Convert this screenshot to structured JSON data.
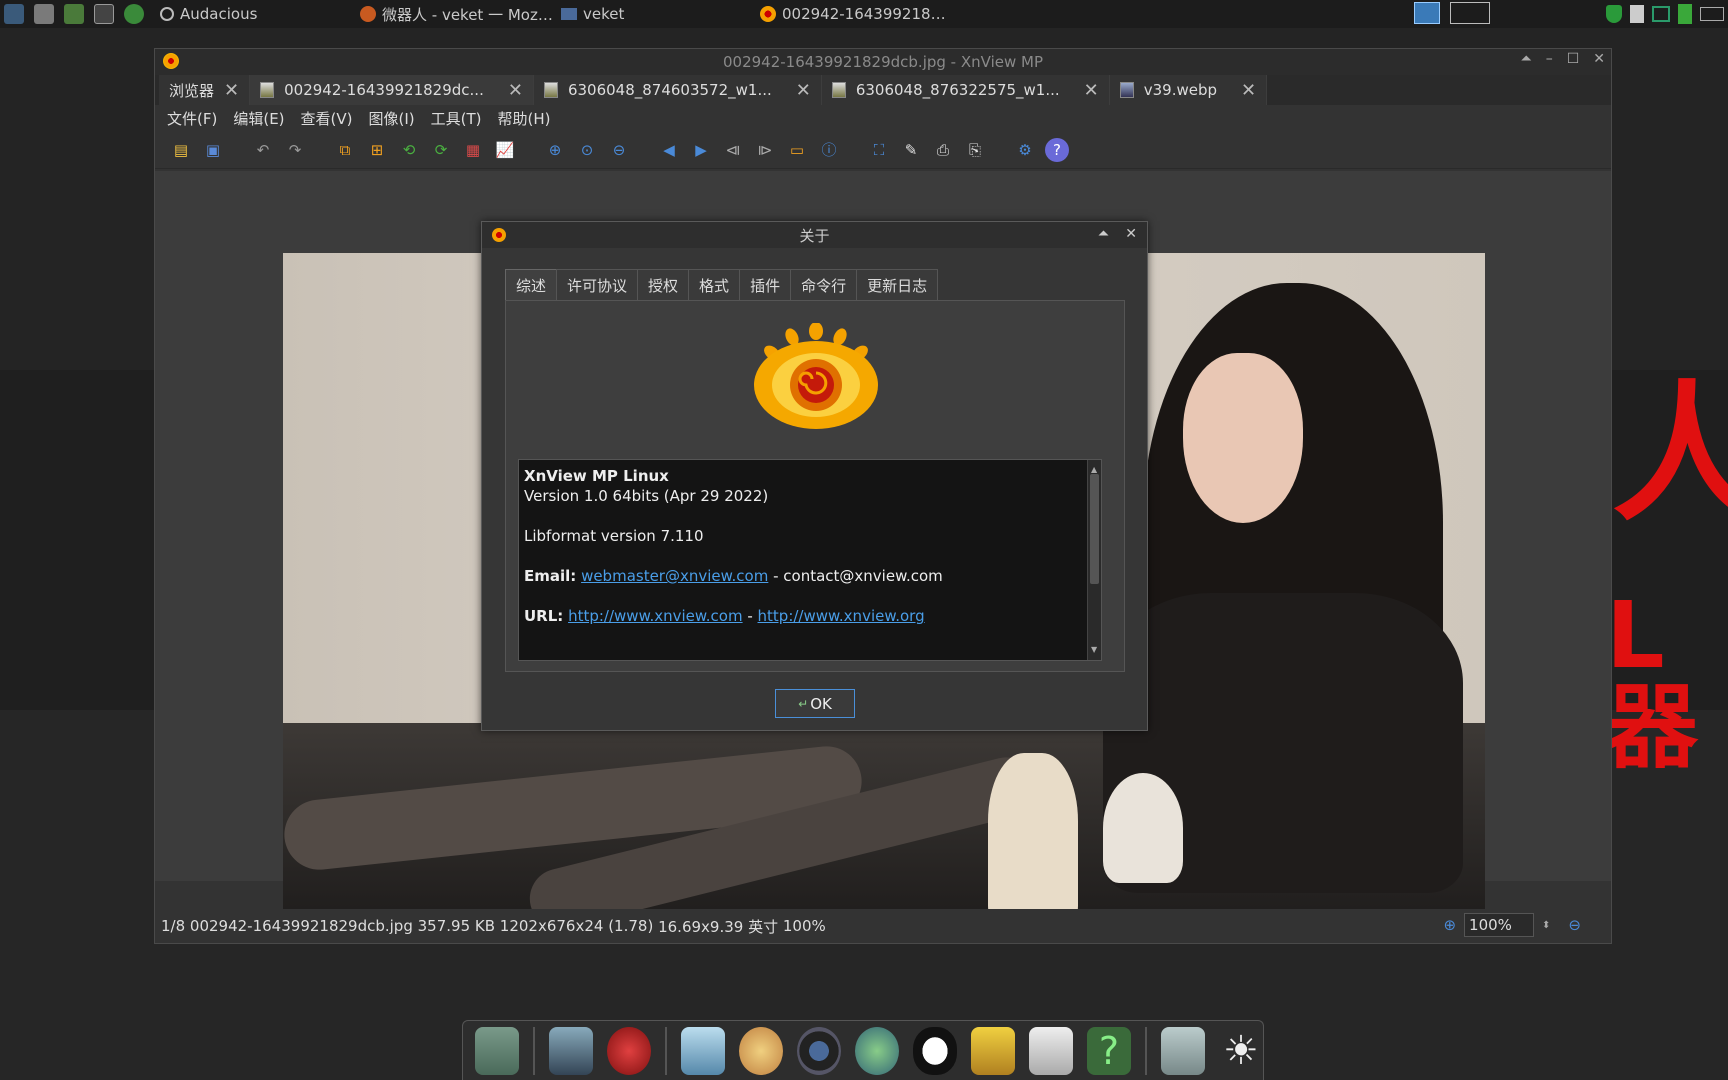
{
  "top_panel": {
    "tasks": [
      {
        "label": "Audacious",
        "icon": "audacious-icon"
      },
      {
        "label": "微器人 - veket 一 Moz…",
        "icon": "firefox-icon"
      },
      {
        "label": "veket",
        "icon": "folder-icon"
      },
      {
        "label": "002942-164399218…",
        "icon": "xnview-icon"
      }
    ]
  },
  "window": {
    "title": "002942-16439921829dcb.jpg - XnView MP",
    "tabs": [
      {
        "label": "浏览器"
      },
      {
        "label": "002942-16439921829dc..."
      },
      {
        "label": "6306048_874603572_w1..."
      },
      {
        "label": "6306048_876322575_w1..."
      },
      {
        "label": "v39.webp"
      }
    ],
    "menu": [
      "文件(F)",
      "编辑(E)",
      "查看(V)",
      "图像(I)",
      "工具(T)",
      "帮助(H)"
    ]
  },
  "status": {
    "index": "1/8",
    "filename": "002942-16439921829dcb.jpg",
    "size": "357.95 KB",
    "dimensions": "1202x676x24 (1.78)",
    "print_size": "16.69x9.39 英寸",
    "zoom": "100%",
    "zoom_input": "100%"
  },
  "about_dialog": {
    "title": "关于",
    "tabs": [
      "综述",
      "许可协议",
      "授权",
      "格式",
      "插件",
      "命令行",
      "更新日志"
    ],
    "info": {
      "product": "XnView MP Linux",
      "version": "Version 1.0 64bits (Apr 29 2022)",
      "libformat": "Libformat version 7.110",
      "email_label": "Email:",
      "email_link": "webmaster@xnview.com",
      "email_sep": " - ",
      "email_other": "contact@xnview.com",
      "url_label": "URL:",
      "url1": "http://www.xnview.com",
      "url_sep": " - ",
      "url2": "http://www.xnview.org"
    },
    "ok_label": "OK"
  },
  "desktop": {
    "text1": "人",
    "text2": "L器"
  },
  "colors": {
    "accent": "#4a8fd8",
    "link": "#4a9ee8",
    "desktop_red": "#e01010"
  }
}
